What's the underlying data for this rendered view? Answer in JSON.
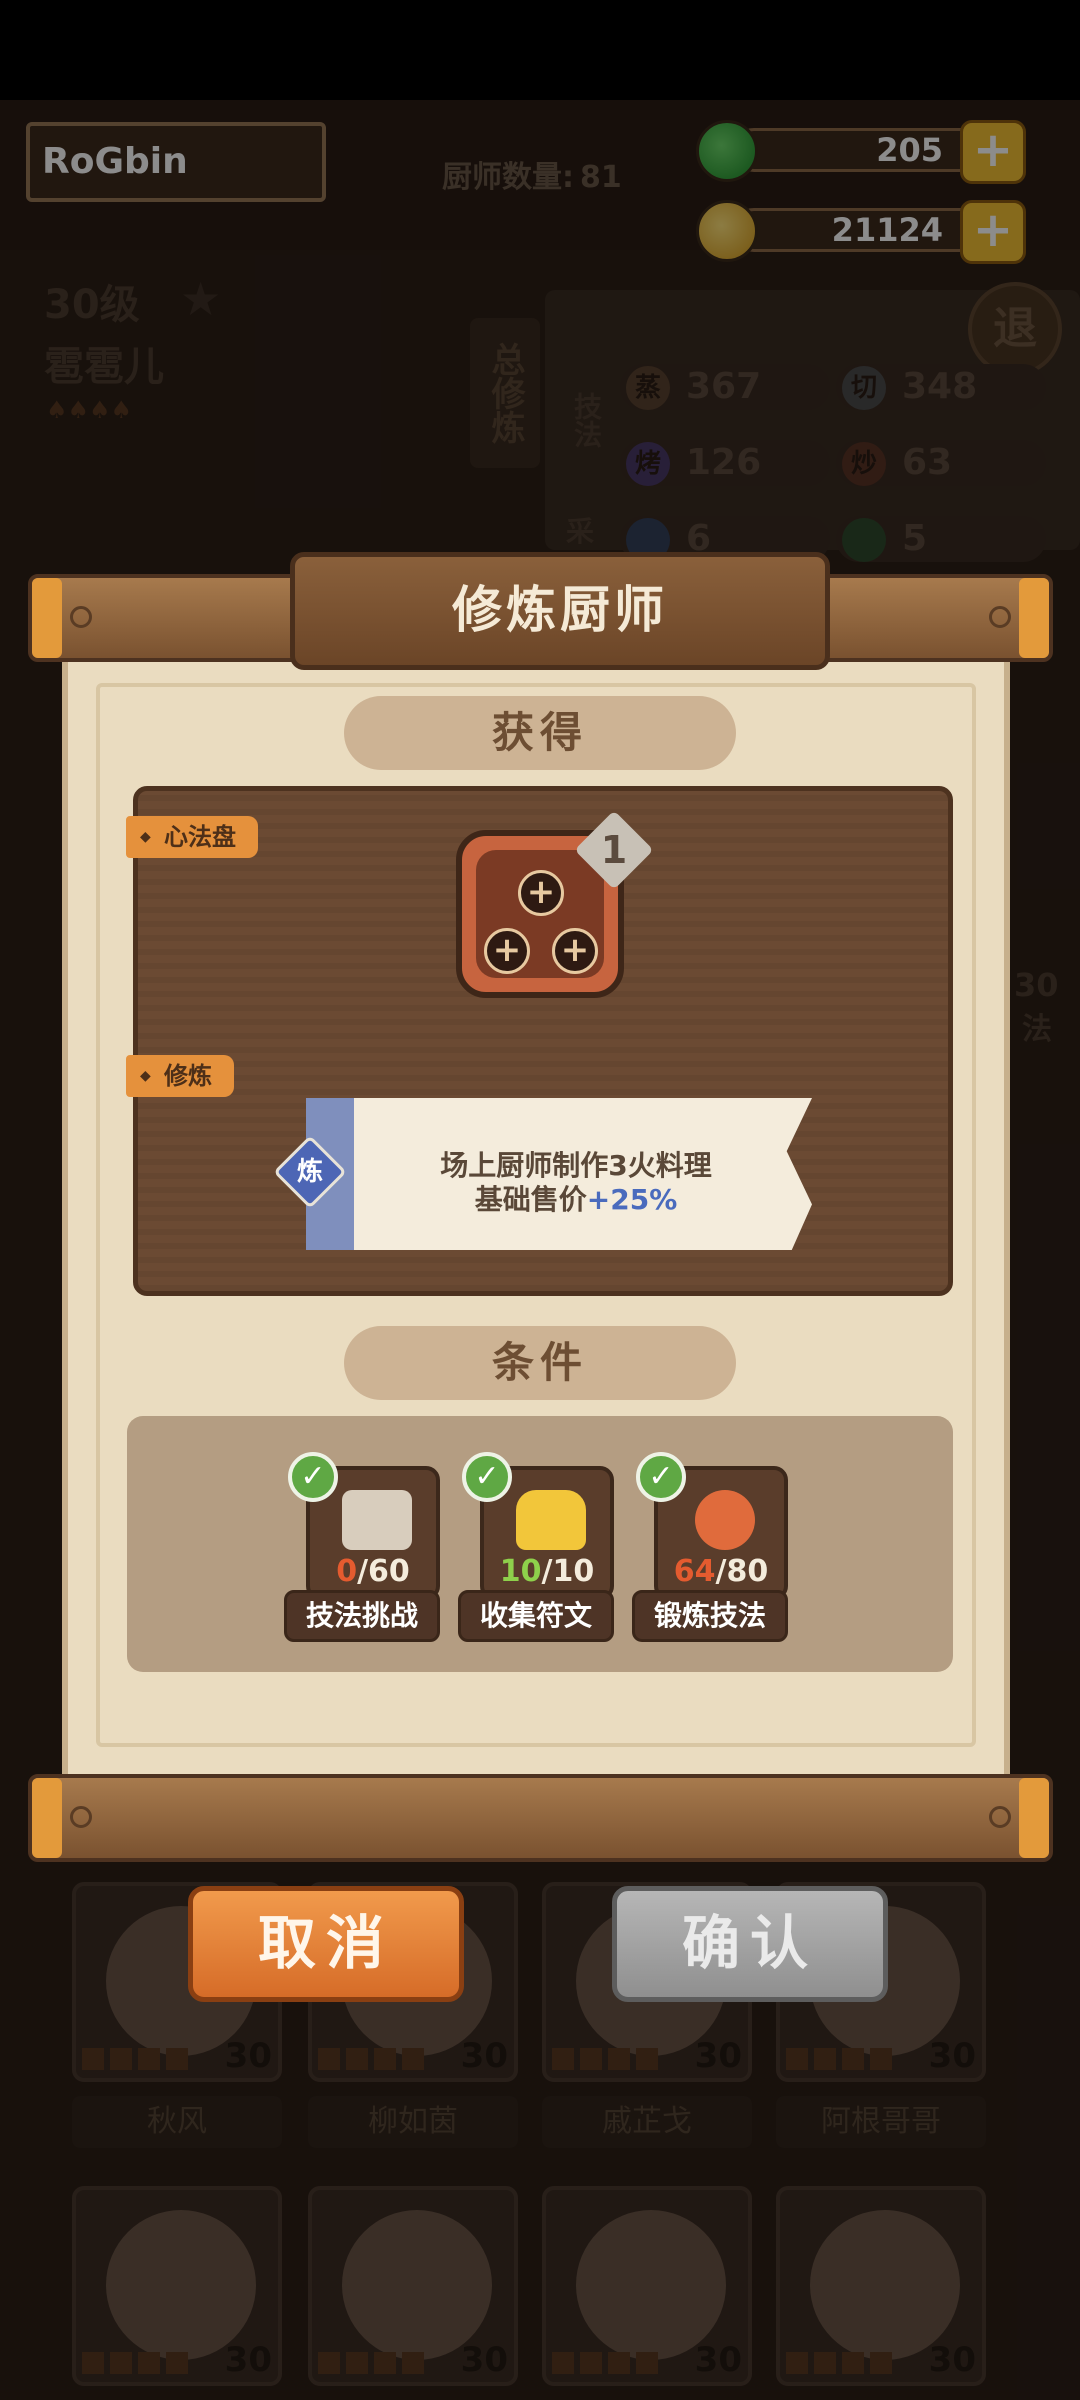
{
  "header": {
    "player_name": "RoGbin",
    "chef_count_label": "厨师数量:",
    "chef_count_value": "81",
    "jade_amount": "205",
    "coin_amount": "21124",
    "plus_glyph": "+"
  },
  "background": {
    "chef_level": "30级",
    "chef_name": "雹雹儿",
    "tab_label": "总修炼",
    "exit_label": "退",
    "skills_label": "技法",
    "collect_label": "采",
    "skills": [
      {
        "icon": "蒸",
        "value": "367"
      },
      {
        "icon": "切",
        "value": "348"
      },
      {
        "icon": "烤",
        "value": "126"
      },
      {
        "icon": "炒",
        "value": "63"
      },
      {
        "icon": "",
        "value": "6"
      },
      {
        "icon": "",
        "value": "5"
      }
    ],
    "side_text_1": "30",
    "side_text_2": "法",
    "chefs_row1": [
      {
        "name": "秋风",
        "level": "30"
      },
      {
        "name": "柳如茵",
        "level": "30"
      },
      {
        "name": "戚芷戈",
        "level": "30"
      },
      {
        "name": "阿根哥哥",
        "level": "30"
      }
    ],
    "chefs_row2": [
      {
        "level": "30"
      },
      {
        "level": "30"
      },
      {
        "level": "30"
      },
      {
        "level": "30"
      }
    ]
  },
  "dialog": {
    "title": "修炼厨师",
    "gain_label": "获得",
    "xinfa_tag": "心法盘",
    "xinfa_count": "1",
    "xiulian_tag": "修炼",
    "lian_badge": "炼",
    "effect_line1": "场上厨师制作3火料理",
    "effect_line2_prefix": "基础售价",
    "effect_line2_boost": "+25%",
    "conditions_label": "条件",
    "conditions": [
      {
        "current": "0",
        "total": "/60",
        "label": "技法挑战",
        "check": "✓"
      },
      {
        "current": "10",
        "total": "/10",
        "label": "收集符文",
        "check": "✓"
      },
      {
        "current": "64",
        "total": "/80",
        "label": "锻炼技法",
        "check": "✓"
      }
    ],
    "cancel_label": "取消",
    "confirm_label": "确认"
  },
  "colors": {
    "accent_orange": "#e5913c",
    "boost_blue": "#4a6bbd",
    "progress_red": "#e45b2f",
    "progress_green": "#8ed04b",
    "check_green": "#5fa844"
  }
}
